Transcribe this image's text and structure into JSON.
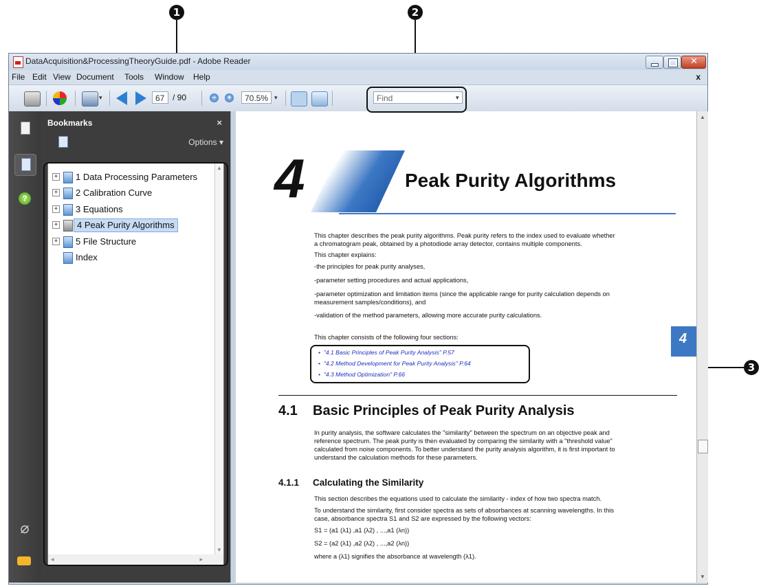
{
  "callouts": [
    "1",
    "2",
    "3"
  ],
  "window": {
    "title": "DataAcquisition&ProcessingTheoryGuide.pdf - Adobe Reader",
    "menu": [
      "File",
      "Edit",
      "View",
      "Document",
      "Tools",
      "Window",
      "Help"
    ],
    "menu_close": "x"
  },
  "toolbar": {
    "page_current": "67",
    "page_total": "/ 90",
    "zoom": "70.5%",
    "find_placeholder": "Find"
  },
  "bookmarks": {
    "title": "Bookmarks",
    "close": "×",
    "options": "Options ▾",
    "items": [
      {
        "label": "1 Data Processing Parameters",
        "expand": "+"
      },
      {
        "label": "2 Calibration Curve",
        "expand": "+"
      },
      {
        "label": "3 Equations",
        "expand": "+"
      },
      {
        "label": "4 Peak Purity Algorithms",
        "expand": "+"
      },
      {
        "label": "5 File Structure",
        "expand": "+"
      },
      {
        "label": "Index",
        "expand": ""
      }
    ]
  },
  "page": {
    "chapter_number": "4",
    "chapter_title": "Peak Purity Algorithms",
    "side_tab": "4",
    "intro_1": "This chapter describes the peak purity algorithms. Peak purity refers to the index used to evaluate whether",
    "intro_2": "a chromatogram peak, obtained by a photodiode array detector, contains multiple components.",
    "explains": "This chapter explains:",
    "bullet_1": "-the principles for peak purity analyses,",
    "bullet_2": "-parameter setting procedures and actual applications,",
    "bullet_3a": "-parameter optimization and limitation items (since the applicable range for purity calculation depends on",
    "bullet_3b": "measurement samples/conditions), and",
    "bullet_4": "-validation of the method parameters, allowing more accurate purity calculations.",
    "consists": "This chapter consists of the following four sections:",
    "links": [
      "\"4.1 Basic Principles of Peak Purity Analysis\" P.57",
      "\"4.2 Method Development for Peak Purity Analysis\" P.64",
      "\"4.3 Method Optimization\" P.66"
    ],
    "s41_num": "4.1",
    "s41_title": "Basic Principles of Peak Purity Analysis",
    "s41_p1": "In purity analysis, the software calculates the \"similarity\" between the spectrum on an objective peak and",
    "s41_p2": "reference spectrum. The peak purity is then evaluated by comparing the similarity with a \"threshold value\"",
    "s41_p3": "calculated from noise components. To better understand the purity analysis algorithm, it is first important to",
    "s41_p4": "understand the calculation methods for these parameters.",
    "s411_num": "4.1.1",
    "s411_title": "Calculating the Similarity",
    "s411_p1": "This section describes the equations used to calculate the similarity - index of how two spectra match.",
    "s411_p2": "To understand the similarity, first consider spectra as sets of absorbances at scanning wavelengths. In this",
    "s411_p3": "case, absorbance spectra S1 and S2 are expressed by the following vectors:",
    "eq1": "S1 = (a1 (λ1) ,a1 (λ2) , ...,a1 (λn))",
    "eq2": "S2 = (a2 (λ1) ,a2 (λ2) , ...,a2 (λn))",
    "s411_p4": "where a (λ1) signifies the absorbance at wavelength (λ1)."
  }
}
